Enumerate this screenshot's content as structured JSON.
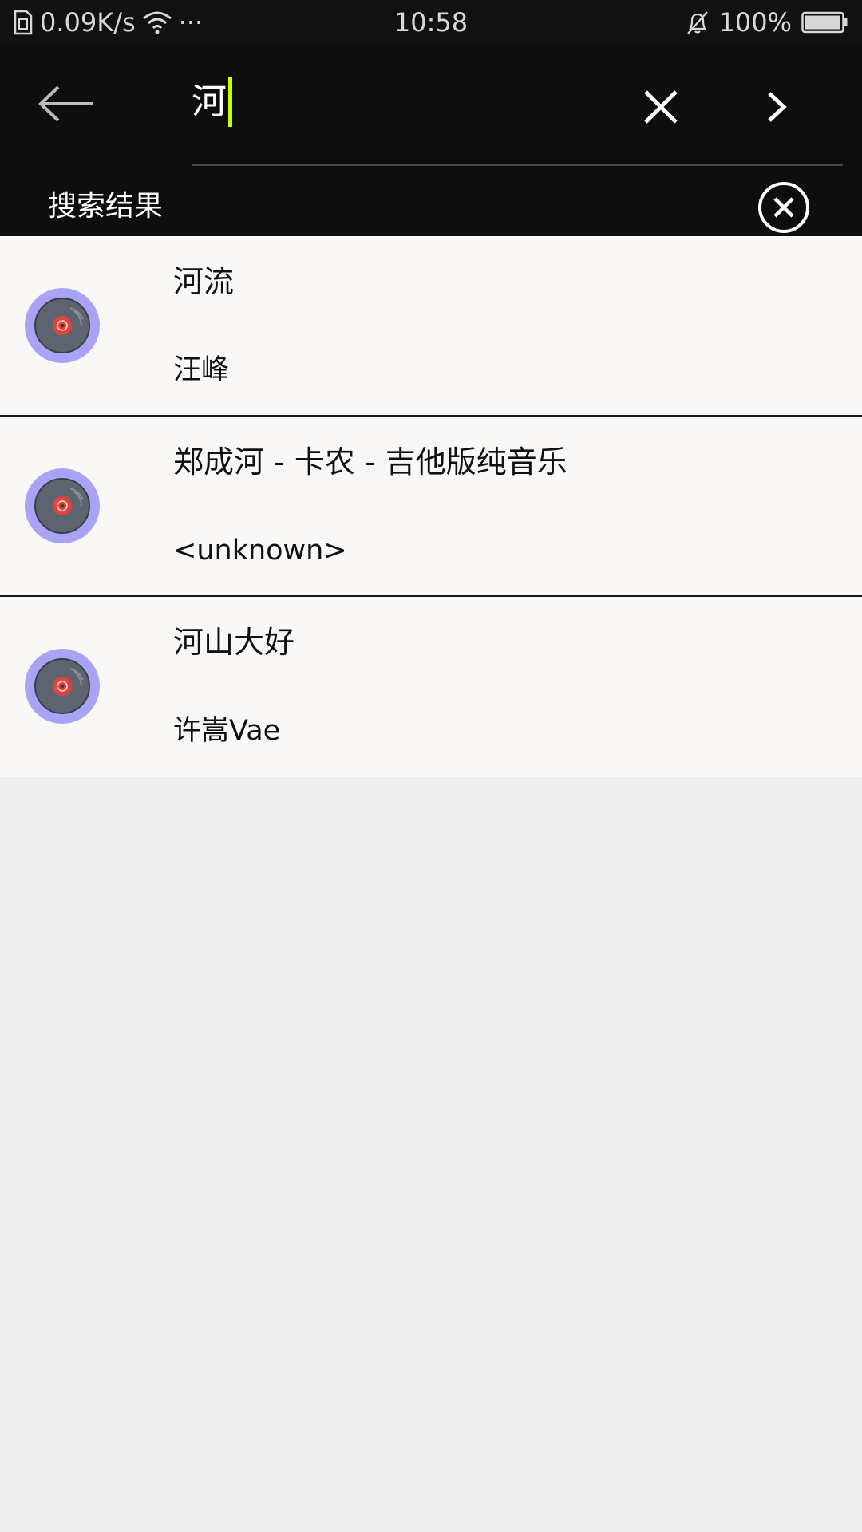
{
  "status_bar": {
    "net_speed": "0.09K/s",
    "dots": "···",
    "time": "10:58",
    "battery": "100%"
  },
  "search": {
    "query": "河",
    "results_label": "搜索结果"
  },
  "results": [
    {
      "title": "河流",
      "artist": "汪峰"
    },
    {
      "title": "郑成河 - 卡农 - 吉他版纯音乐",
      "artist": "<unknown>"
    },
    {
      "title": "河山大好",
      "artist": "许嵩Vae"
    }
  ],
  "icons": {
    "back": "arrow-left-icon",
    "clear": "close-icon",
    "go": "chevron-right-icon",
    "close_results": "circle-close-icon",
    "song": "vinyl-disc-icon"
  },
  "colors": {
    "header_bg": "#0e0e0e",
    "caret": "#c8ff00",
    "list_bg": "#f9f8f7",
    "page_bg": "#efeff0",
    "disc_ring": "#a9a3f5"
  }
}
